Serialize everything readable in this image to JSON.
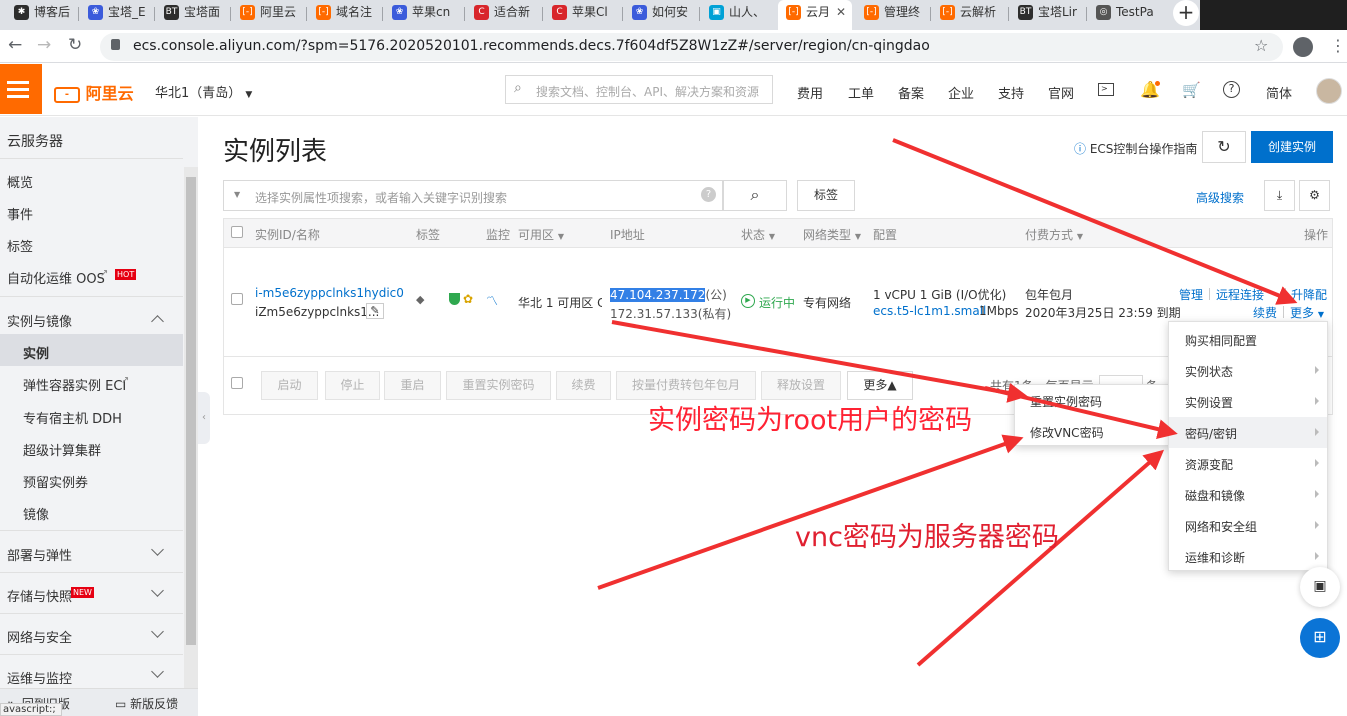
{
  "browser": {
    "tabs": [
      {
        "label": "博客后",
        "icon": "paw-icon",
        "color": "#2d2d2d"
      },
      {
        "label": "宝塔_E",
        "icon": "baidu-paw-icon",
        "color": "#3b5bdb"
      },
      {
        "label": "宝塔面",
        "icon": "bt-icon",
        "color": "#2d2d2d"
      },
      {
        "label": "阿里云",
        "icon": "aliyun-icon",
        "color": "#ff6a00"
      },
      {
        "label": "域名注",
        "icon": "aliyun-icon",
        "color": "#ff6a00"
      },
      {
        "label": "苹果cn",
        "icon": "baidu-paw-icon",
        "color": "#3b5bdb"
      },
      {
        "label": "适合新",
        "icon": "csdn-icon",
        "color": "#d8262b"
      },
      {
        "label": "苹果Cl",
        "icon": "csdn-icon",
        "color": "#d8262b"
      },
      {
        "label": "如何安",
        "icon": "baidu-paw-icon",
        "color": "#3b5bdb"
      },
      {
        "label": "山人、",
        "icon": "bilibili-icon",
        "color": "#00a1d6"
      },
      {
        "label": "云月",
        "icon": "aliyun-icon",
        "color": "#ff6a00"
      },
      {
        "label": "管理终",
        "icon": "aliyun-icon",
        "color": "#ff6a00"
      },
      {
        "label": "云解析",
        "icon": "aliyun-icon",
        "color": "#ff6a00"
      },
      {
        "label": "宝塔Lir",
        "icon": "bt-icon",
        "color": "#2d2d2d"
      },
      {
        "label": "TestPa",
        "icon": "globe-icon",
        "color": "#555555"
      }
    ],
    "url": "ecs.console.aliyun.com/?spm=5176.2020520101.recommends.decs.7f604df5Z8W1zZ#/server/region/cn-qingdao",
    "status_text": "avascript:;"
  },
  "topnav": {
    "logo_text": "阿里云",
    "region": "华北1（青岛）",
    "search_placeholder": "搜索文档、控制台、API、解决方案和资源",
    "items": [
      "费用",
      "工单",
      "备案",
      "企业",
      "支持",
      "官网"
    ],
    "lang": "简体"
  },
  "sidebar": {
    "title": "云服务器",
    "items": {
      "overview": "概览",
      "events": "事件",
      "tags": "标签",
      "oos": "自动化运维 OOS",
      "hot_badge": "HOT",
      "instances_images": "实例与镜像",
      "instances": "实例",
      "eci": "弹性容器实例 ECI",
      "ddh": "专有宿主机 DDH",
      "supercomputing": "超级计算集群",
      "reserved": "预留实例券",
      "images": "镜像",
      "deploy": "部署与弹性",
      "storage": "存储与快照",
      "new_badge": "NEW",
      "network": "网络与安全",
      "ops": "运维与监控",
      "old_version": "回到旧版",
      "feedback": "新版反馈"
    }
  },
  "page": {
    "title": "实例列表",
    "guide": "ECS控制台操作指南",
    "create_button": "创建实例",
    "search_placeholder": "选择实例属性项搜索，或者输入关键字识别搜索",
    "tag_button": "标签",
    "advanced_search": "高级搜索"
  },
  "table": {
    "headers": {
      "id": "实例ID/名称",
      "tag": "标签",
      "monitor": "监控",
      "zone": "可用区",
      "ip": "IP地址",
      "status": "状态",
      "network": "网络类型",
      "config": "配置",
      "billing": "付费方式",
      "actions": "操作"
    },
    "row": {
      "id": "i-m5e6zyppclnks1hydic0",
      "name": "iZm5e6zyppclnks1...",
      "zone": "华北 1 可用区 C",
      "public_ip": "47.104.237.172",
      "public_suffix": "(公)",
      "private_ip": "172.31.57.133(私有)",
      "status": "运行中",
      "network": "专有网络",
      "config1": "1 vCPU 1 GiB (I/O优化)",
      "config2": "ecs.t5-lc1m1.small",
      "bandwidth": "1Mbps",
      "billing1": "包年包月",
      "billing2": "2020年3月25日 23:59 到期",
      "action_manage": "管理",
      "action_remote": "远程连接",
      "action_upgrade": "升降配",
      "action_renew": "续费",
      "action_more": "更多"
    },
    "footer_buttons": [
      "启动",
      "停止",
      "重启",
      "重置实例密码",
      "续费",
      "按量付费转包年包月",
      "释放设置"
    ],
    "footer_more": "更多▲",
    "pagination_text": "共有1条，每页显示",
    "pagination_suffix": "条"
  },
  "dropdown": {
    "items": [
      "购买相同配置",
      "实例状态",
      "实例设置",
      "密码/密钥",
      "资源变配",
      "磁盘和镜像",
      "网络和安全组",
      "运维和诊断"
    ]
  },
  "submenu": {
    "items": [
      "重置实例密码",
      "修改VNC密码"
    ]
  },
  "annotations": {
    "text1": "实例密码为root用户的密码",
    "text2": "vnc密码为服务器密码",
    "color": "#f03030"
  }
}
